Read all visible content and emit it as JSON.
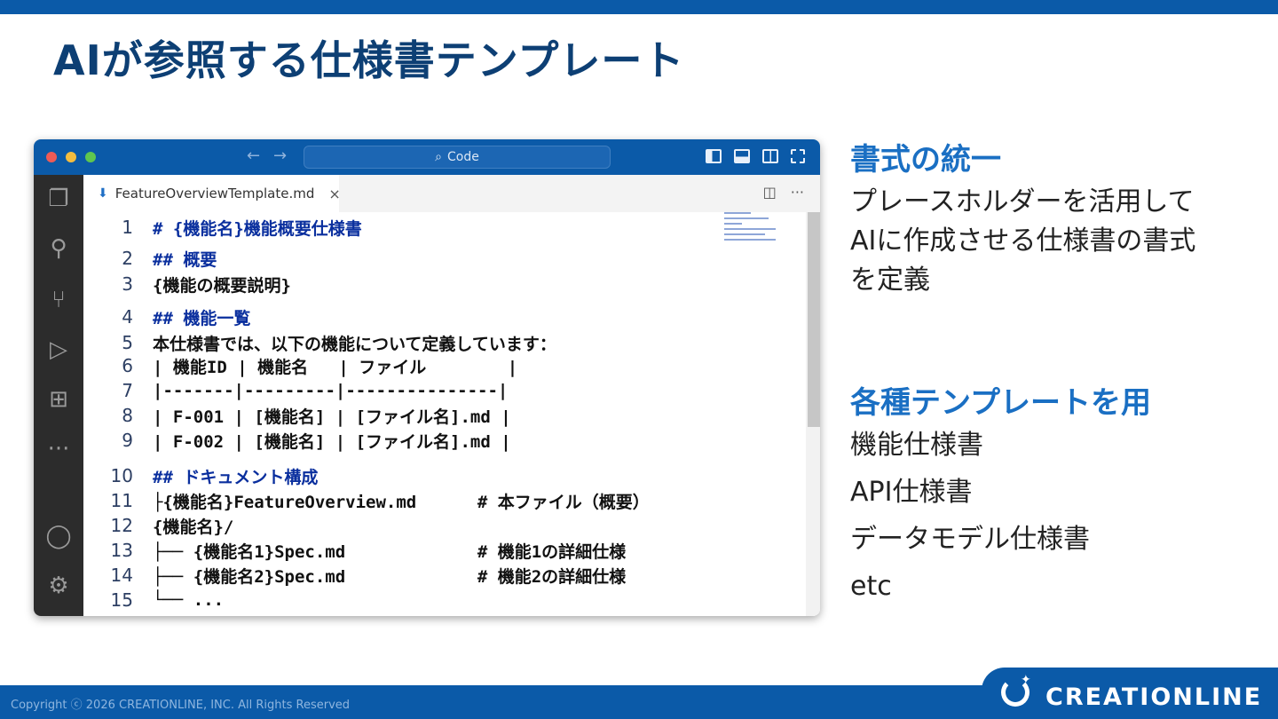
{
  "slide": {
    "title": "AIが参照する仕様書テンプレート"
  },
  "window": {
    "search_label": "Code",
    "tab_title": "FeatureOverviewTemplate.md",
    "tab_close": "×",
    "tab_actions": [
      "◫",
      "···"
    ]
  },
  "code_lines": [
    {
      "n": "1",
      "text": "# {機能名}機能概要仕様書",
      "heading": true
    },
    {
      "n": "2",
      "text": "## 概要",
      "heading": true
    },
    {
      "n": "3",
      "text": "{機能の概要説明}",
      "heading": false
    },
    {
      "n": "4",
      "text": "## 機能一覧",
      "heading": true
    },
    {
      "n": "5",
      "text": "本仕様書では、以下の機能について定義しています：",
      "heading": false
    },
    {
      "n": "6",
      "text": "| 機能ID | 機能名   | ファイル        |",
      "heading": false
    },
    {
      "n": "7",
      "text": "|-------|---------|---------------|",
      "heading": false
    },
    {
      "n": "8",
      "text": "| F-001 | [機能名] | [ファイル名].md |",
      "heading": false
    },
    {
      "n": "9",
      "text": "| F-002 | [機能名] | [ファイル名].md |",
      "heading": false
    },
    {
      "n": "10",
      "text": "## ドキュメント構成",
      "heading": true
    },
    {
      "n": "11",
      "text": "├{機能名}FeatureOverview.md      # 本ファイル（概要）",
      "heading": false
    },
    {
      "n": "12",
      "text": "{機能名}/",
      "heading": false
    },
    {
      "n": "13",
      "text": "├── {機能名1}Spec.md             # 機能1の詳細仕様",
      "heading": false
    },
    {
      "n": "14",
      "text": "├── {機能名2}Spec.md             # 機能2の詳細仕様",
      "heading": false
    },
    {
      "n": "15",
      "text": "└── ...",
      "heading": false
    }
  ],
  "right": {
    "section1_heading": "書式の統一",
    "section1_lines": [
      "プレースホルダーを活用して",
      "AIに作成させる仕様書の書式",
      "を定義"
    ],
    "section2_heading": "各種テンプレートを用",
    "section2_items": [
      "機能仕様書",
      "API仕様書",
      "データモデル仕様書",
      "etc"
    ]
  },
  "footer": {
    "copyright": "Copyright ⓒ 2026 CREATIONLINE, INC. All Rights Reserved",
    "logo_text": "CREATIONLINE"
  },
  "colors": {
    "brand_blue": "#0b5aa8",
    "title_navy": "#0d3f74",
    "accent_blue": "#1a6fc3",
    "code_heading": "#0a2f9e"
  },
  "icons": [
    "explorer-icon",
    "search-icon",
    "source-control-icon",
    "run-debug-icon",
    "extensions-icon",
    "more-icon",
    "account-icon",
    "settings-gear-icon"
  ]
}
